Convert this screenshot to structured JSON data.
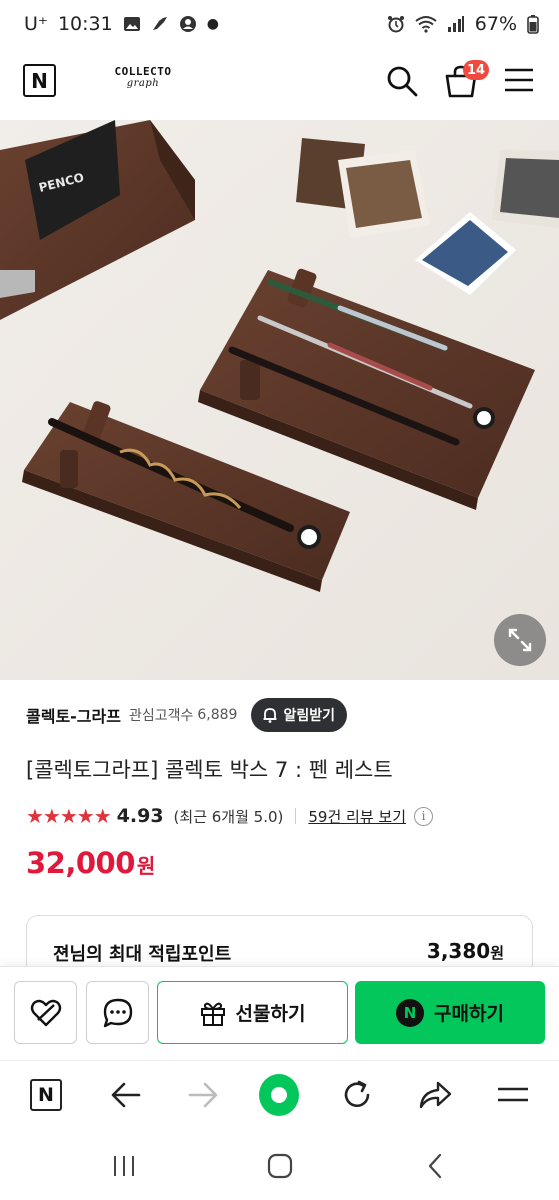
{
  "status_bar": {
    "carrier": "U⁺",
    "time": "10:31",
    "battery": "67%"
  },
  "header": {
    "logo_letter": "N",
    "brand_name": "COLLECTO",
    "brand_sub": "graph",
    "cart_count": "14",
    "icons": [
      "naver-logo-icon",
      "search-icon",
      "cart-icon",
      "menu-icon"
    ]
  },
  "product_image": {
    "box_label": "PENCO",
    "icons": [
      "expand-icon"
    ]
  },
  "seller": {
    "name": "콜렉토-그라프",
    "follower_label": "관심고객수",
    "follower_count": "6,889",
    "notify_label": "알림받기"
  },
  "product": {
    "title": "[콜렉토그라프] 콜렉토 박스 7 : 펜 레스트",
    "stars": "★★★★★",
    "rating": "4.93",
    "rating_recent": "(최근 6개월 5.0)",
    "review_link": "59건 리뷰 보기",
    "info_glyph": "i",
    "price": "32,000",
    "price_unit": "원",
    "accent_color": "#e0193c"
  },
  "points": {
    "label": "젼님의 최대 적립포인트",
    "value": "3,380",
    "unit": "원"
  },
  "actions": {
    "gift_label": "선물하기",
    "buy_label": "구매하기",
    "buy_badge": "N",
    "brand_green": "#03c75a",
    "icons": [
      "wishlist-icon",
      "chat-icon",
      "gift-icon"
    ]
  },
  "browser_nav": {
    "logo_letter": "N",
    "icons": [
      "naver-home-icon",
      "back-arrow-icon",
      "forward-arrow-icon",
      "home-circle-icon",
      "refresh-icon",
      "share-icon",
      "menu-icon"
    ]
  },
  "system_nav": {
    "icons": [
      "recent-apps-icon",
      "home-icon",
      "back-icon"
    ]
  }
}
